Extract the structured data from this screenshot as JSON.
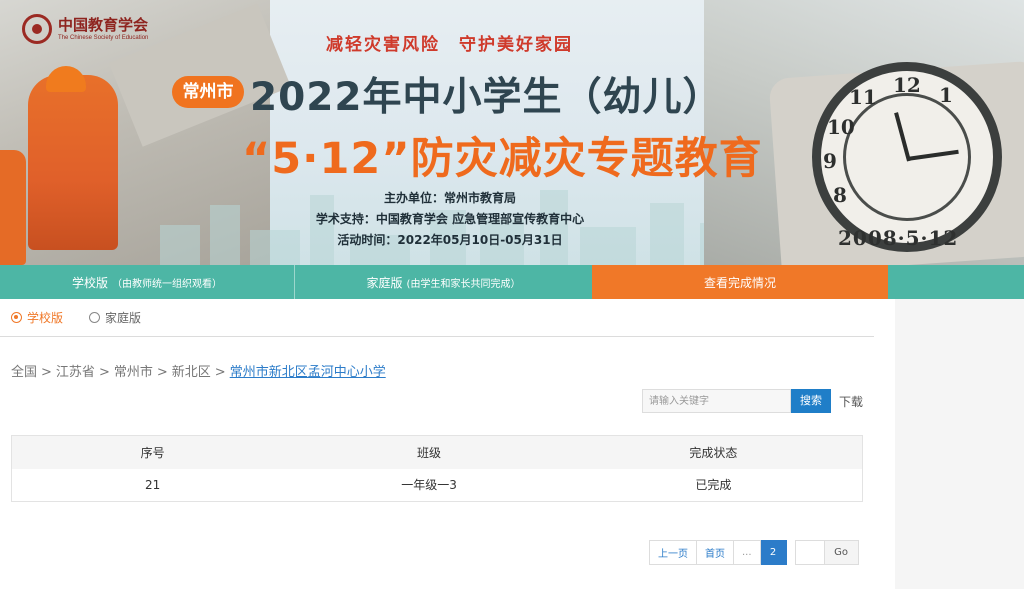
{
  "banner": {
    "logo_cn": "中国教育学会",
    "logo_en": "The Chinese Society of Education",
    "slogan": "减轻灾害风险　守护美好家园",
    "city_badge": "常州市",
    "title_line1": "2022年中小学生（幼儿）",
    "title_line2": "“5·12”防灾减灾专题教育",
    "organizer": "主办单位：常州市教育局",
    "support": "学术支持：中国教育学会 应急管理部宣传教育中心",
    "activity_time": "活动时间：2022年05月10日-05月31日",
    "stone_date": "2008·5·12",
    "clock_numbers": [
      "12",
      "1",
      "11",
      "10",
      "9",
      "8"
    ]
  },
  "tabs": [
    {
      "label": "学校版",
      "note": "（由教师统一组织观看）"
    },
    {
      "label": "家庭版",
      "note": "(由学生和家长共同完成）"
    },
    {
      "label": "查看完成情况",
      "note": ""
    }
  ],
  "subtabs": {
    "school": "学校版",
    "family": "家庭版",
    "selected": "school"
  },
  "breadcrumb": {
    "items": [
      "全国",
      "江苏省",
      "常州市",
      "新北区"
    ],
    "separator": ">",
    "current": "常州市新北区孟河中心小学"
  },
  "search": {
    "placeholder": "请输入关键字",
    "button": "搜索",
    "download": "下载"
  },
  "table": {
    "headers": [
      "序号",
      "班级",
      "完成状态"
    ],
    "rows": [
      [
        "21",
        "一年级一3",
        "已完成"
      ]
    ]
  },
  "pagination": {
    "prev": "上一页",
    "first": "首页",
    "ellipsis": "...",
    "current": "2",
    "go": "Go"
  },
  "colors": {
    "tab_green": "#4db6a5",
    "tab_orange": "#f07828",
    "link_blue": "#2c7cc9",
    "button_blue": "#1f7ec8"
  }
}
